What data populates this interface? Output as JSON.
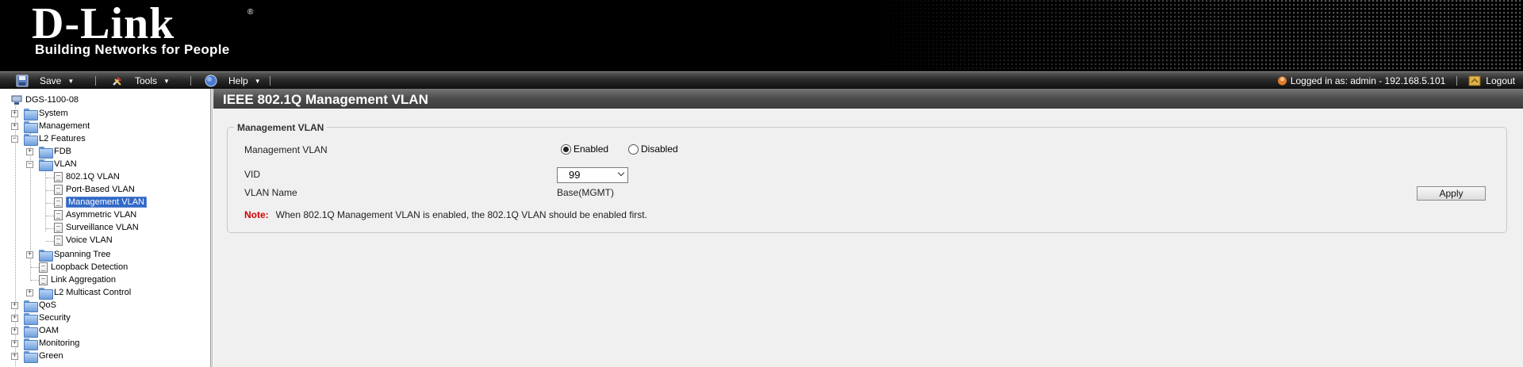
{
  "brand": {
    "logo_text": "D-Link",
    "registered_mark": "®",
    "tagline": "Building Networks for People"
  },
  "menubar": {
    "save_label": "Save",
    "tools_label": "Tools",
    "help_label": "Help",
    "logged_in_text": "Logged in as: admin - 192.168.5.101",
    "logout_label": "Logout"
  },
  "tree": {
    "root": "DGS-1100-08",
    "system": "System",
    "management": "Management",
    "l2_features": "L2 Features",
    "fdb": "FDB",
    "vlan": "VLAN",
    "vlan_8021q": "802.1Q VLAN",
    "vlan_port_based": "Port-Based VLAN",
    "vlan_management": "Management VLAN",
    "vlan_asymmetric": "Asymmetric VLAN",
    "vlan_surveillance": "Surveillance VLAN",
    "vlan_voice": "Voice VLAN",
    "spanning_tree": "Spanning Tree",
    "loopback_detection": "Loopback Detection",
    "link_aggregation": "Link Aggregation",
    "l2_multicast_control": "L2 Multicast Control",
    "qos": "QoS",
    "security": "Security",
    "oam": "OAM",
    "monitoring": "Monitoring",
    "green": "Green"
  },
  "main": {
    "title": "IEEE 802.1Q Management VLAN",
    "section_legend": "Management VLAN",
    "mgmt_vlan_label": "Management VLAN",
    "enabled_label": "Enabled",
    "disabled_label": "Disabled",
    "mgmt_vlan_state": "Enabled",
    "vid_label": "VID",
    "vid_value": "99",
    "vlan_name_label": "VLAN Name",
    "vlan_name_value": "Base(MGMT)",
    "apply_label": "Apply",
    "note_label": "Note:",
    "note_text": "When 802.1Q Management VLAN is enabled, the 802.1Q VLAN should be enabled first."
  },
  "colors": {
    "selected_highlight": "#3169c6",
    "note_red": "#d00000",
    "title_bar": "#4b4b4b"
  },
  "icons": [
    "save-icon",
    "tools-icon",
    "help-icon",
    "user-icon",
    "logout-icon",
    "switch-icon",
    "folder-icon",
    "page-icon"
  ]
}
